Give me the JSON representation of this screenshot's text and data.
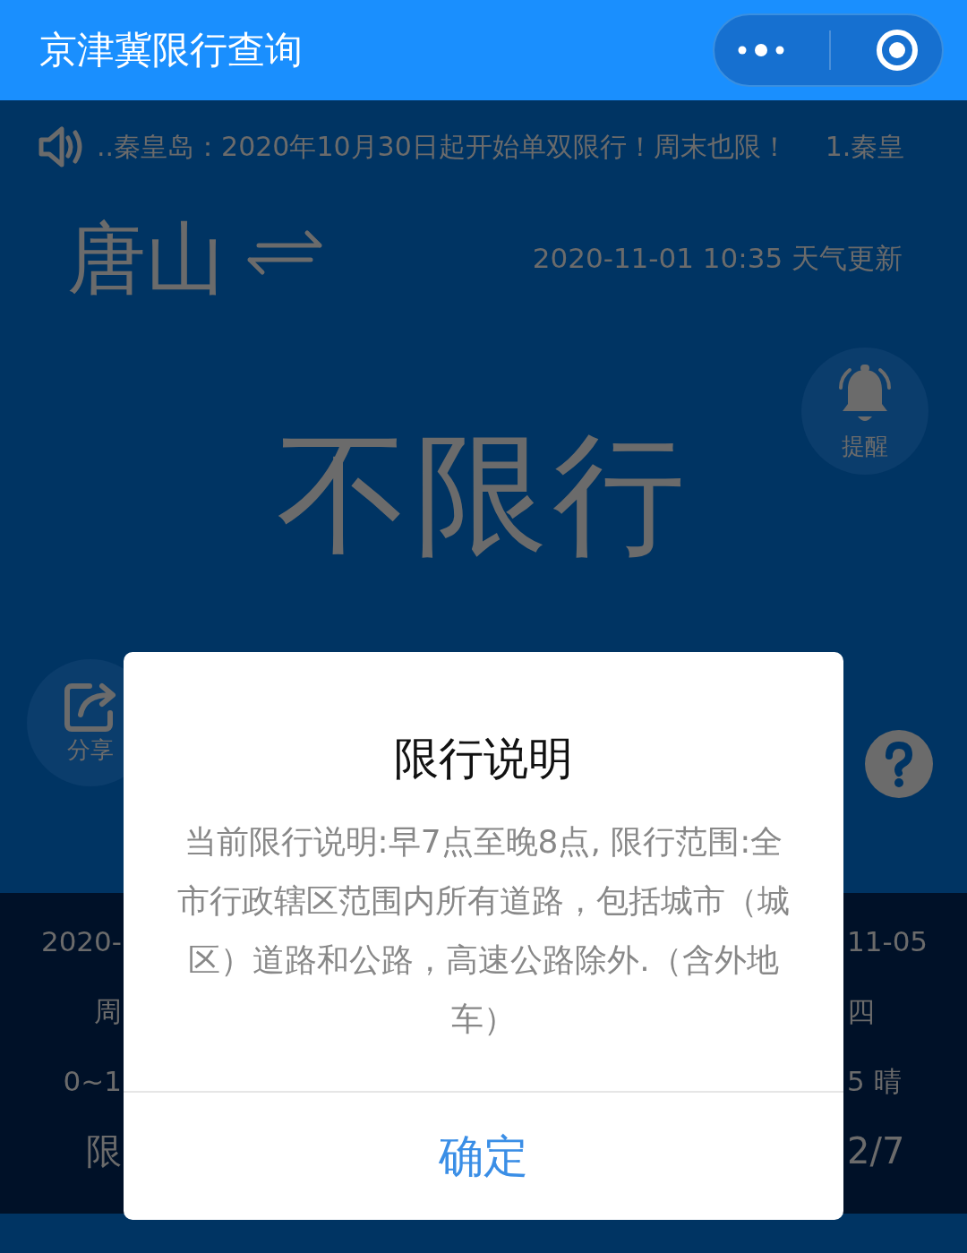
{
  "header": {
    "title": "京津冀限行查询"
  },
  "notice": {
    "items": [
      "..秦皇岛：2020年10月30日起开始单双限行！周末也限！",
      "1.秦皇"
    ]
  },
  "city": {
    "name": "唐山",
    "updated": "2020-11-01 10:35 天气更新"
  },
  "status": "不限行",
  "reminder": {
    "label": "提醒"
  },
  "share": {
    "label": "分享"
  },
  "forecast": {
    "left": [
      "2020-",
      "周",
      "0~1",
      "限"
    ],
    "right": [
      "11-05",
      "四",
      "5 晴",
      "2/7"
    ]
  },
  "dialog": {
    "title": "限行说明",
    "body": "当前限行说明:早7点至晚8点, 限行范围:全市行政辖区范围内所有道路，包括城市（城区）道路和公路，高速公路除外.（含外地车）",
    "confirm": "确定"
  }
}
